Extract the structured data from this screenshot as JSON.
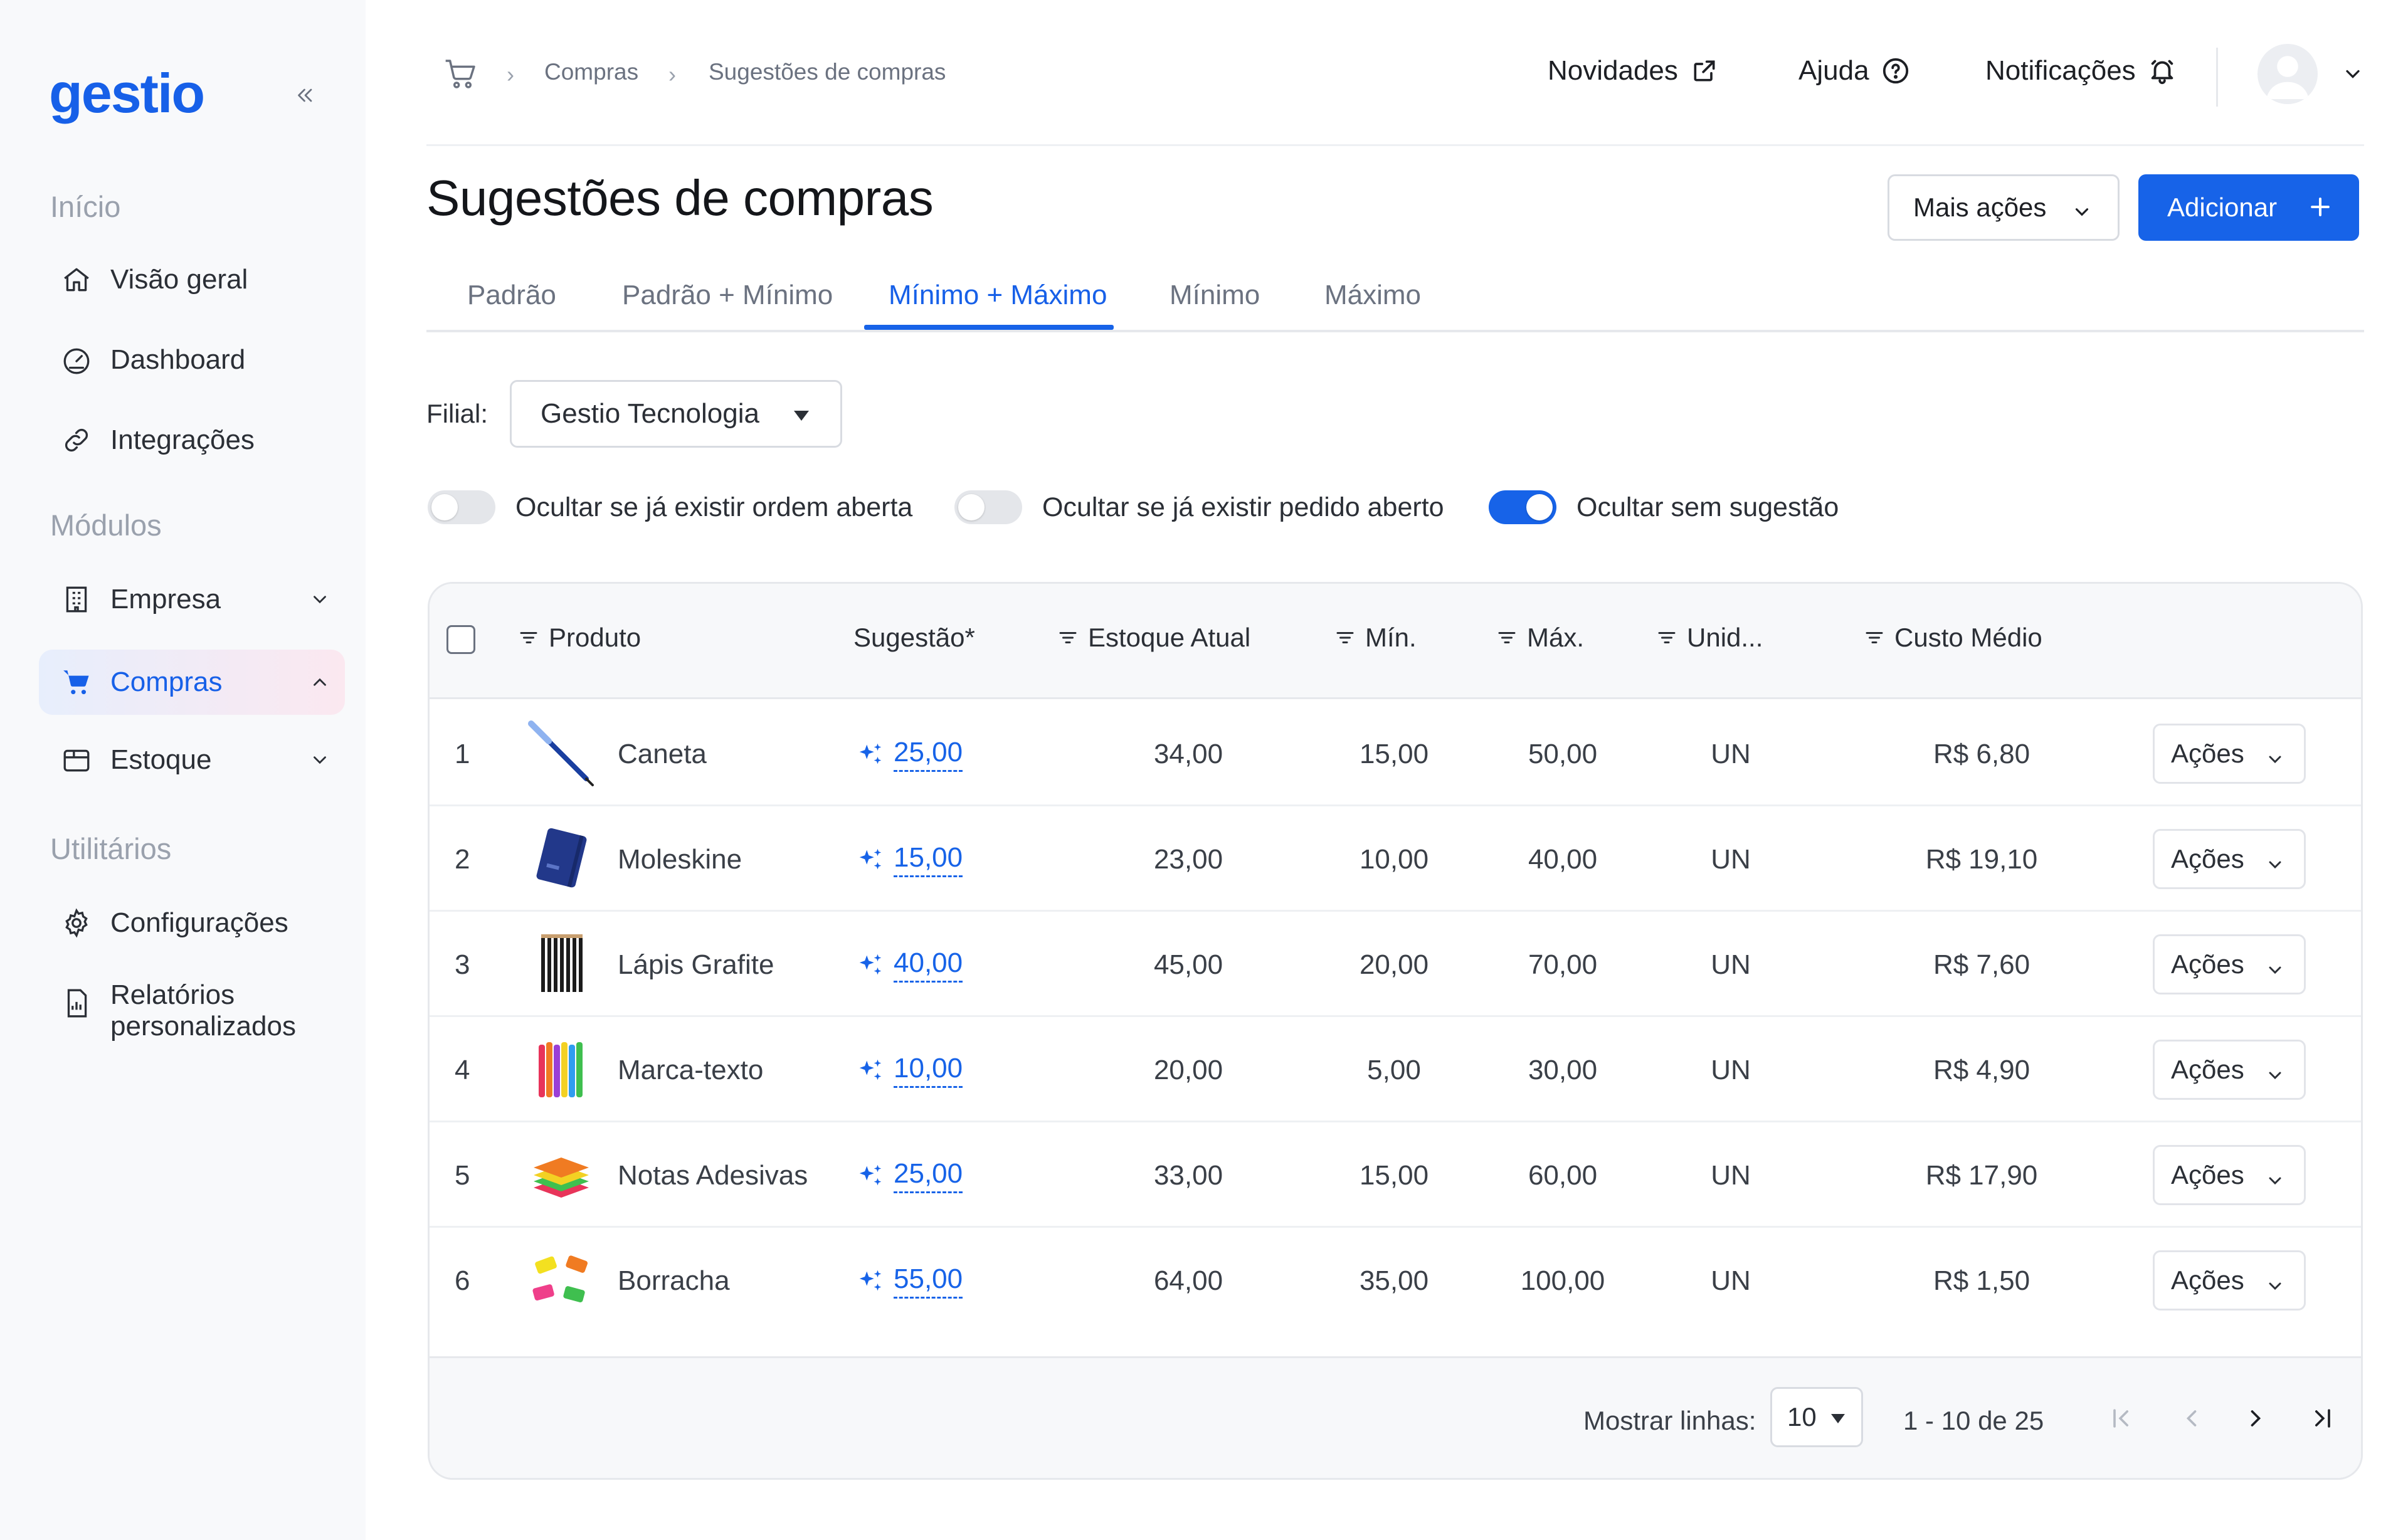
{
  "app": {
    "logo": "gestio"
  },
  "sidebar": {
    "section_inicio": "Início",
    "section_modulos": "Módulos",
    "section_utilitarios": "Utilitários",
    "items": [
      {
        "label": "Visão geral",
        "icon": "home-icon"
      },
      {
        "label": "Dashboard",
        "icon": "gauge-icon"
      },
      {
        "label": "Integrações",
        "icon": "link-icon"
      },
      {
        "label": "Empresa",
        "icon": "building-icon"
      },
      {
        "label": "Compras",
        "icon": "cart-icon"
      },
      {
        "label": "Estoque",
        "icon": "box-icon"
      },
      {
        "label": "Configurações",
        "icon": "gear-icon"
      },
      {
        "label_line1": "Relatórios",
        "label_line2": "personalizados",
        "icon": "report-icon"
      }
    ]
  },
  "breadcrumb": {
    "items": [
      "Compras",
      "Sugestões de compras"
    ]
  },
  "topbar": {
    "novidades": "Novidades",
    "ajuda": "Ajuda",
    "notificacoes": "Notificações"
  },
  "page": {
    "title": "Sugestões de compras",
    "more_actions": "Mais ações",
    "add": "Adicionar"
  },
  "tabs": [
    "Padrão",
    "Padrão + Mínimo",
    "Mínimo + Máximo",
    "Mínimo",
    "Máximo"
  ],
  "active_tab": "Mínimo + Máximo",
  "filter": {
    "label": "Filial:",
    "value": "Gestio Tecnologia"
  },
  "toggles": [
    {
      "label": "Ocultar se já existir ordem aberta",
      "on": false
    },
    {
      "label": "Ocultar se já existir pedido aberto",
      "on": false
    },
    {
      "label": "Ocultar sem sugestão",
      "on": true
    }
  ],
  "table": {
    "columns": [
      "Produto",
      "Sugestão*",
      "Estoque Atual",
      "Mín.",
      "Máx.",
      "Unid...",
      "Custo Médio"
    ],
    "rows": [
      {
        "n": "1",
        "produto": "Caneta",
        "sugestao": "25,00",
        "estoque": "34,00",
        "min": "15,00",
        "max": "50,00",
        "unid": "UN",
        "custo": "R$ 6,80",
        "acoes": "Ações"
      },
      {
        "n": "2",
        "produto": "Moleskine",
        "sugestao": "15,00",
        "estoque": "23,00",
        "min": "10,00",
        "max": "40,00",
        "unid": "UN",
        "custo": "R$ 19,10",
        "acoes": "Ações"
      },
      {
        "n": "3",
        "produto": "Lápis Grafite",
        "sugestao": "40,00",
        "estoque": "45,00",
        "min": "20,00",
        "max": "70,00",
        "unid": "UN",
        "custo": "R$ 7,60",
        "acoes": "Ações"
      },
      {
        "n": "4",
        "produto": "Marca-texto",
        "sugestao": "10,00",
        "estoque": "20,00",
        "min": "5,00",
        "max": "30,00",
        "unid": "UN",
        "custo": "R$ 4,90",
        "acoes": "Ações"
      },
      {
        "n": "5",
        "produto": "Notas Adesivas",
        "sugestao": "25,00",
        "estoque": "33,00",
        "min": "15,00",
        "max": "60,00",
        "unid": "UN",
        "custo": "R$ 17,90",
        "acoes": "Ações"
      },
      {
        "n": "6",
        "produto": "Borracha",
        "sugestao": "55,00",
        "estoque": "64,00",
        "min": "35,00",
        "max": "100,00",
        "unid": "UN",
        "custo": "R$ 1,50",
        "acoes": "Ações"
      }
    ]
  },
  "pagination": {
    "label": "Mostrar linhas:",
    "rows_per_page": "10",
    "range": "1 - 10 de 25"
  },
  "colors": {
    "accent": "#1763e8",
    "sidebar_bg": "#f8f9fb"
  }
}
